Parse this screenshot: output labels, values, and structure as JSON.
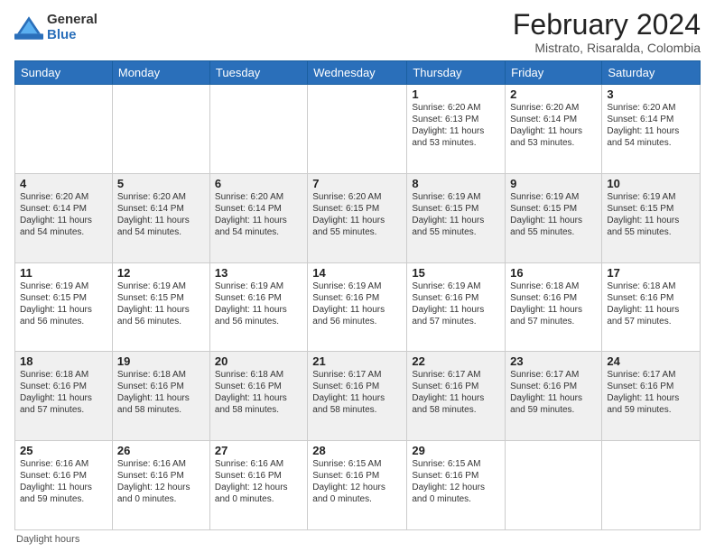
{
  "logo": {
    "general": "General",
    "blue": "Blue"
  },
  "title": "February 2024",
  "subtitle": "Mistrato, Risaralda, Colombia",
  "headers": [
    "Sunday",
    "Monday",
    "Tuesday",
    "Wednesday",
    "Thursday",
    "Friday",
    "Saturday"
  ],
  "footer": "Daylight hours",
  "weeks": [
    {
      "days": [
        {
          "num": "",
          "info": ""
        },
        {
          "num": "",
          "info": ""
        },
        {
          "num": "",
          "info": ""
        },
        {
          "num": "",
          "info": ""
        },
        {
          "num": "1",
          "info": "Sunrise: 6:20 AM\nSunset: 6:13 PM\nDaylight: 11 hours\nand 53 minutes."
        },
        {
          "num": "2",
          "info": "Sunrise: 6:20 AM\nSunset: 6:14 PM\nDaylight: 11 hours\nand 53 minutes."
        },
        {
          "num": "3",
          "info": "Sunrise: 6:20 AM\nSunset: 6:14 PM\nDaylight: 11 hours\nand 54 minutes."
        }
      ]
    },
    {
      "days": [
        {
          "num": "4",
          "info": "Sunrise: 6:20 AM\nSunset: 6:14 PM\nDaylight: 11 hours\nand 54 minutes."
        },
        {
          "num": "5",
          "info": "Sunrise: 6:20 AM\nSunset: 6:14 PM\nDaylight: 11 hours\nand 54 minutes."
        },
        {
          "num": "6",
          "info": "Sunrise: 6:20 AM\nSunset: 6:14 PM\nDaylight: 11 hours\nand 54 minutes."
        },
        {
          "num": "7",
          "info": "Sunrise: 6:20 AM\nSunset: 6:15 PM\nDaylight: 11 hours\nand 55 minutes."
        },
        {
          "num": "8",
          "info": "Sunrise: 6:19 AM\nSunset: 6:15 PM\nDaylight: 11 hours\nand 55 minutes."
        },
        {
          "num": "9",
          "info": "Sunrise: 6:19 AM\nSunset: 6:15 PM\nDaylight: 11 hours\nand 55 minutes."
        },
        {
          "num": "10",
          "info": "Sunrise: 6:19 AM\nSunset: 6:15 PM\nDaylight: 11 hours\nand 55 minutes."
        }
      ]
    },
    {
      "days": [
        {
          "num": "11",
          "info": "Sunrise: 6:19 AM\nSunset: 6:15 PM\nDaylight: 11 hours\nand 56 minutes."
        },
        {
          "num": "12",
          "info": "Sunrise: 6:19 AM\nSunset: 6:15 PM\nDaylight: 11 hours\nand 56 minutes."
        },
        {
          "num": "13",
          "info": "Sunrise: 6:19 AM\nSunset: 6:16 PM\nDaylight: 11 hours\nand 56 minutes."
        },
        {
          "num": "14",
          "info": "Sunrise: 6:19 AM\nSunset: 6:16 PM\nDaylight: 11 hours\nand 56 minutes."
        },
        {
          "num": "15",
          "info": "Sunrise: 6:19 AM\nSunset: 6:16 PM\nDaylight: 11 hours\nand 57 minutes."
        },
        {
          "num": "16",
          "info": "Sunrise: 6:18 AM\nSunset: 6:16 PM\nDaylight: 11 hours\nand 57 minutes."
        },
        {
          "num": "17",
          "info": "Sunrise: 6:18 AM\nSunset: 6:16 PM\nDaylight: 11 hours\nand 57 minutes."
        }
      ]
    },
    {
      "days": [
        {
          "num": "18",
          "info": "Sunrise: 6:18 AM\nSunset: 6:16 PM\nDaylight: 11 hours\nand 57 minutes."
        },
        {
          "num": "19",
          "info": "Sunrise: 6:18 AM\nSunset: 6:16 PM\nDaylight: 11 hours\nand 58 minutes."
        },
        {
          "num": "20",
          "info": "Sunrise: 6:18 AM\nSunset: 6:16 PM\nDaylight: 11 hours\nand 58 minutes."
        },
        {
          "num": "21",
          "info": "Sunrise: 6:17 AM\nSunset: 6:16 PM\nDaylight: 11 hours\nand 58 minutes."
        },
        {
          "num": "22",
          "info": "Sunrise: 6:17 AM\nSunset: 6:16 PM\nDaylight: 11 hours\nand 58 minutes."
        },
        {
          "num": "23",
          "info": "Sunrise: 6:17 AM\nSunset: 6:16 PM\nDaylight: 11 hours\nand 59 minutes."
        },
        {
          "num": "24",
          "info": "Sunrise: 6:17 AM\nSunset: 6:16 PM\nDaylight: 11 hours\nand 59 minutes."
        }
      ]
    },
    {
      "days": [
        {
          "num": "25",
          "info": "Sunrise: 6:16 AM\nSunset: 6:16 PM\nDaylight: 11 hours\nand 59 minutes."
        },
        {
          "num": "26",
          "info": "Sunrise: 6:16 AM\nSunset: 6:16 PM\nDaylight: 12 hours\nand 0 minutes."
        },
        {
          "num": "27",
          "info": "Sunrise: 6:16 AM\nSunset: 6:16 PM\nDaylight: 12 hours\nand 0 minutes."
        },
        {
          "num": "28",
          "info": "Sunrise: 6:15 AM\nSunset: 6:16 PM\nDaylight: 12 hours\nand 0 minutes."
        },
        {
          "num": "29",
          "info": "Sunrise: 6:15 AM\nSunset: 6:16 PM\nDaylight: 12 hours\nand 0 minutes."
        },
        {
          "num": "",
          "info": ""
        },
        {
          "num": "",
          "info": ""
        }
      ]
    }
  ]
}
